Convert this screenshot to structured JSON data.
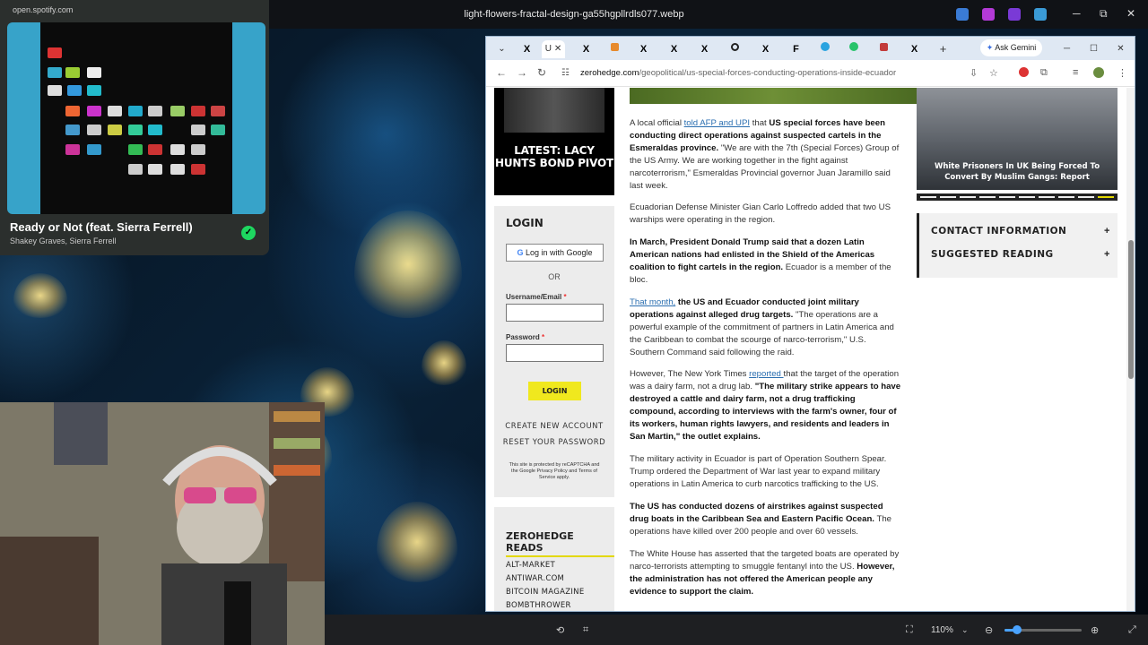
{
  "os": {
    "window_title": "light-flowers-fractal-design-ga55hgpllrdls077.webp",
    "controls": {
      "minimize": "─",
      "maximize": "⧉",
      "close": "✕"
    }
  },
  "spotify": {
    "url": "open.spotify.com",
    "song_title": "Ready or Not (feat. Sierra Ferrell)",
    "artists": "Shakey Graves, Sierra Ferrell",
    "liked_icon": "check-circle-icon",
    "accent": "#1ed760"
  },
  "browser": {
    "gemini_label": "Ask Gemini",
    "url_host": "zerohedge.com",
    "url_path": "/geopolitical/us-special-forces-conducting-operations-inside-ecuador",
    "tab_letters": [
      "X",
      "U",
      "X",
      "",
      "X",
      "X",
      "X",
      "",
      "X",
      "F",
      "",
      "",
      "",
      "X"
    ],
    "window_controls": {
      "minimize": "─",
      "maximize": "☐",
      "close": "✕"
    }
  },
  "sidebar": {
    "promo_headline": "LATEST: LACY HUNTS BOND PIVOT",
    "login": {
      "heading": "LOGIN",
      "google_button": "Log in with Google",
      "or_text": "OR",
      "username_label": "Username/Email",
      "password_label": "Password",
      "required_mark": "*",
      "login_button": "LOGIN",
      "create_account": "CREATE NEW ACCOUNT",
      "reset_password": "RESET YOUR PASSWORD",
      "captcha_note": "This site is protected by reCAPTCHA and the Google Privacy Policy and Terms of Service apply."
    },
    "reads": {
      "heading": "ZEROHEDGE READS",
      "items": [
        "ALT-MARKET",
        "ANTIWAR.COM",
        "BITCOIN MAGAZINE",
        "BOMBTHROWER"
      ]
    }
  },
  "article": {
    "p1_pre": "A local official ",
    "p1_link": "told AFP and UPI",
    "p1_mid": " that ",
    "p1_bold": "US special forces have been conducting direct operations against suspected cartels in the Esmeraldas province.",
    "p1_rest": " \"We are with the 7th (Special Forces) Group of the US Army. We are working together in the fight against narcoterrorism,\" Esmeraldas Provincial governor Juan Jaramillo said last week.",
    "p2": "Ecuadorian Defense Minister Gian Carlo Loffredo added that two US warships were operating in the region.",
    "p3_bold": "In March, President Donald Trump said that a dozen Latin American nations had enlisted in the Shield of the Americas coalition to fight cartels in the region.",
    "p3_rest": " Ecuador is a member of the bloc.",
    "p4_link": "That month,",
    "p4_bold": " the US and Ecuador conducted joint military operations against alleged drug targets.",
    "p4_rest": " \"The operations are a powerful example of the commitment of partners in Latin America and the Caribbean to combat the scourge of narco-terrorism,\" U.S. Southern Command said following the raid.",
    "p5_pre": "However, The New York Times ",
    "p5_link": "reported ",
    "p5_mid": "that the target of the operation was a dairy farm, not a drug lab. ",
    "p5_bold": "\"The military strike appears to have destroyed a cattle and dairy farm, not a drug trafficking compound, according to interviews with the farm's owner, four of its workers, human rights lawyers, and residents and leaders in San Martin,\" the outlet explains.",
    "p6": "The military activity in Ecuador is part of Operation Southern Spear. Trump ordered the Department of War last year to expand military operations in Latin America to curb narcotics trafficking to the US.",
    "p7_bold": "The US has conducted dozens of airstrikes against suspected drug boats in the Caribbean Sea and Eastern Pacific Ocean.",
    "p7_rest": " The operations have killed over 200 people and over 60 vessels.",
    "p8_pre": "The White House has asserted that the targeted boats are operated by narco-terrorists attempting to smuggle fentanyl into the US. ",
    "p8_bold": "However, the administration has not offered the American people any evidence to support the claim."
  },
  "right_column": {
    "feature_caption": "White Prisoners In UK Being Forced To Convert By Muslim Gangs: Report",
    "contact": "CONTACT INFORMATION",
    "suggested": "SUGGESTED READING",
    "expand_symbol": "+"
  },
  "taskbar": {
    "zoom_level": "110%",
    "zoom_fraction": 0.16
  }
}
